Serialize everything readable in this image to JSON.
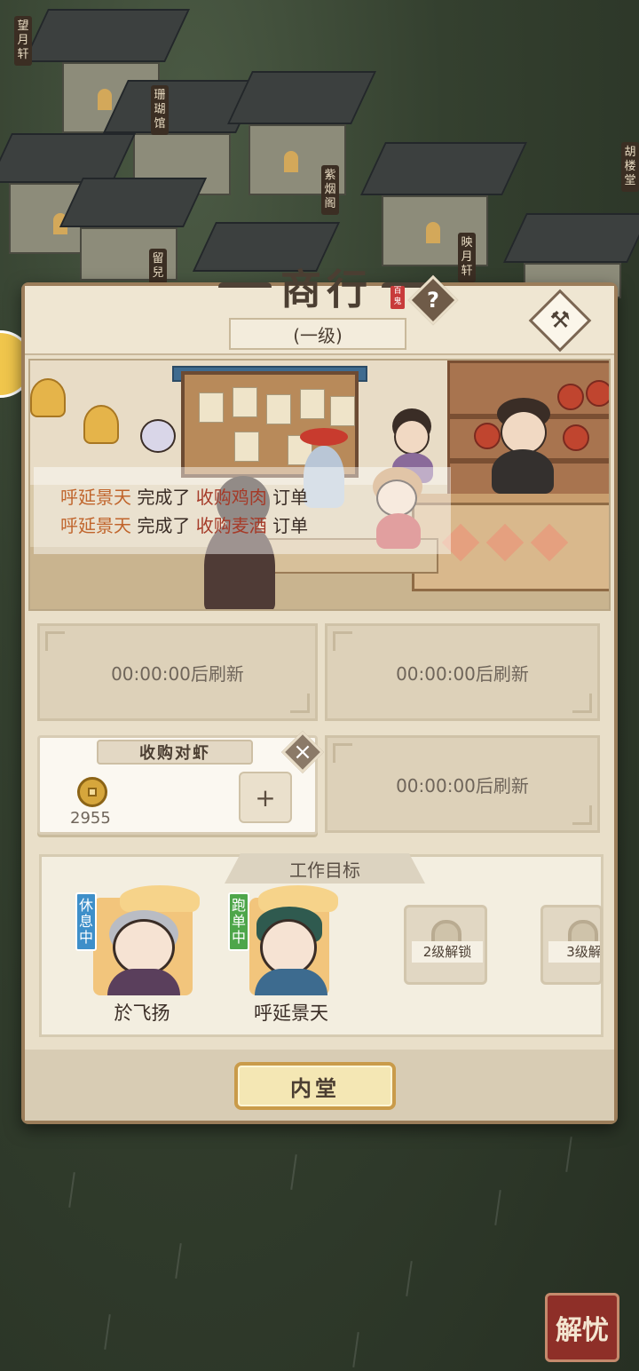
{
  "town": {
    "signs": [
      "望月轩",
      "珊瑚馆",
      "紫烟阁",
      "映月轩",
      "留兒",
      "胡楼堂"
    ]
  },
  "panel": {
    "title": "商行",
    "seal_text": "百鬼",
    "help_label": "?",
    "level": "(一级)",
    "hammer_label": "⚒"
  },
  "log": [
    {
      "who": "呼延景天",
      "verb": " 完成了 ",
      "what": "收购鸡肉",
      "tail": " 订单"
    },
    {
      "who": "呼延景天",
      "verb": " 完成了 ",
      "what": "收购麦酒",
      "tail": " 订单"
    }
  ],
  "slots": {
    "refresh_1": "00:00:00后刷新",
    "refresh_2": "00:00:00后刷新",
    "refresh_3": "00:00:00后刷新"
  },
  "order": {
    "tag": "收购对虾",
    "amount": "2955",
    "plus_label": "+",
    "close_label": "×"
  },
  "targets": {
    "title": "工作目标",
    "workers": [
      {
        "name": "於飞扬",
        "state": "休息中",
        "state_color": "#3e8fc9"
      },
      {
        "name": "呼延景天",
        "state": "跑单中",
        "state_color": "#4ea64a"
      }
    ],
    "locks": [
      "2级解锁",
      "3级解"
    ]
  },
  "footer": {
    "main_button": "内堂"
  },
  "corner_badge": "解忧"
}
